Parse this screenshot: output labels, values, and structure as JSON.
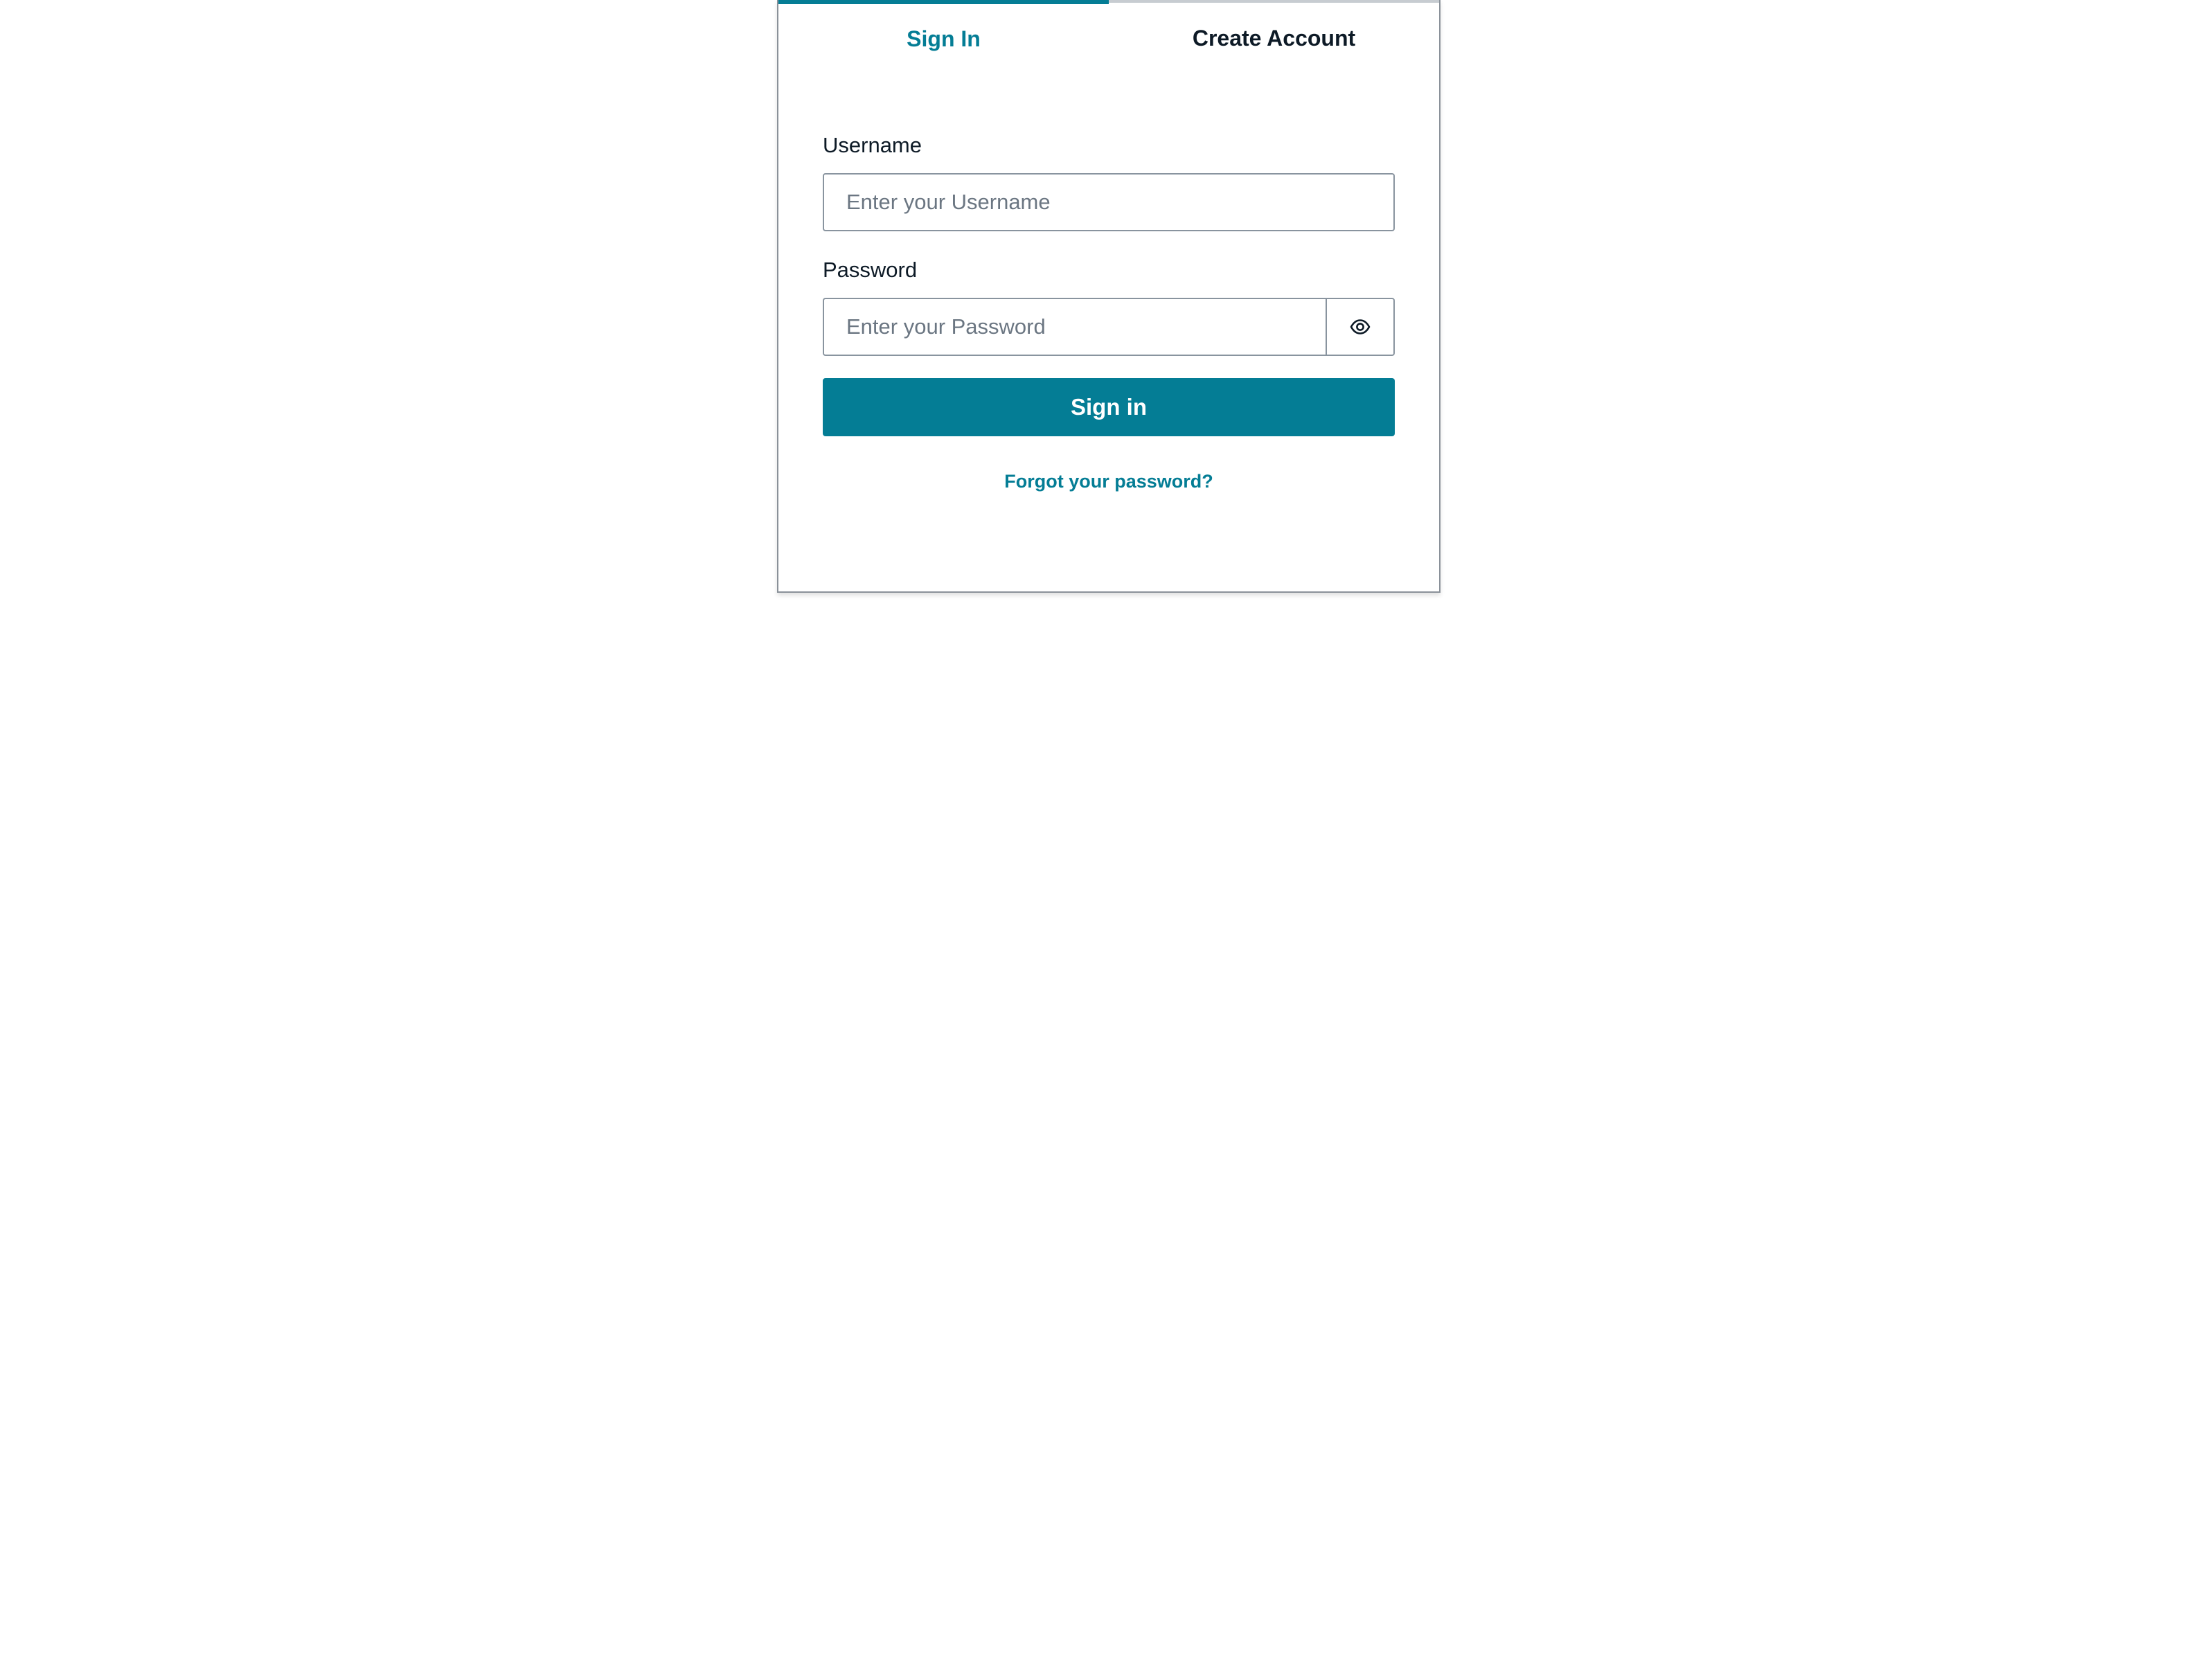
{
  "tabs": {
    "sign_in": "Sign In",
    "create_account": "Create Account"
  },
  "form": {
    "username_label": "Username",
    "username_placeholder": "Enter your Username",
    "password_label": "Password",
    "password_placeholder": "Enter your Password",
    "show_password_icon": "eye-icon",
    "submit_label": "Sign in",
    "forgot_label": "Forgot your password?"
  },
  "colors": {
    "accent": "#047d95",
    "text": "#0d1a26",
    "border": "#89949f"
  }
}
